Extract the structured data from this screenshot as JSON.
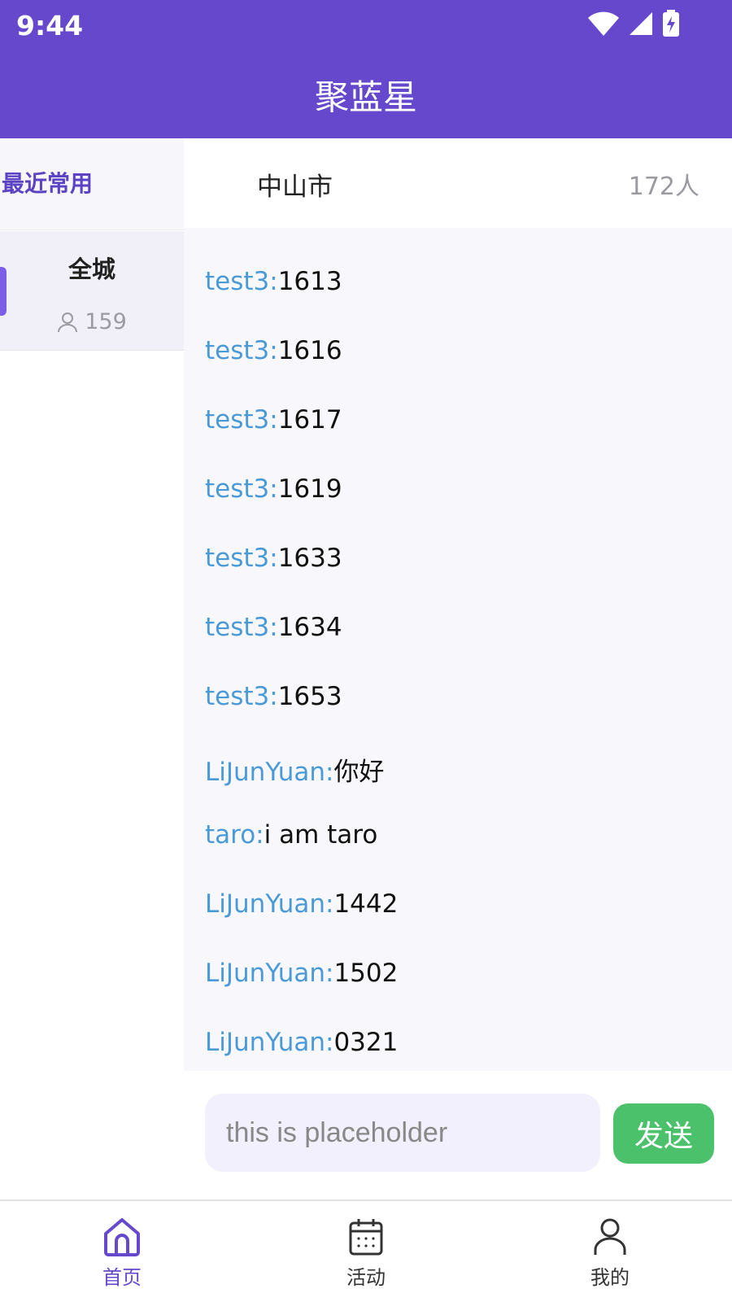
{
  "status_bar": {
    "time": "9:44"
  },
  "header": {
    "title": "聚蓝星"
  },
  "sidebar": {
    "recent_label": "最近常用",
    "city": {
      "name": "全城",
      "count": "159"
    }
  },
  "chat": {
    "room_name": "中山市",
    "room_count": "172人",
    "clipped_text": "",
    "messages": [
      {
        "user": "test3:",
        "text": "1613"
      },
      {
        "user": "test3:",
        "text": "1616"
      },
      {
        "user": "test3:",
        "text": "1617"
      },
      {
        "user": "test3:",
        "text": "1619"
      },
      {
        "user": "test3:",
        "text": "1633"
      },
      {
        "user": "test3:",
        "text": "1634"
      },
      {
        "user": "test3:",
        "text": "1653"
      },
      {
        "user": "LiJunYuan:",
        "text": "你好"
      },
      {
        "user": "taro:",
        "text": "i am taro"
      },
      {
        "user": "LiJunYuan:",
        "text": "1442"
      },
      {
        "user": "LiJunYuan:",
        "text": "1502"
      },
      {
        "user": "LiJunYuan:",
        "text": "0321"
      }
    ],
    "input_placeholder": "this is placeholder",
    "send_label": "发送"
  },
  "nav": {
    "items": [
      {
        "label": "首页",
        "icon": "home-icon",
        "active": true
      },
      {
        "label": "活动",
        "icon": "calendar-icon",
        "active": false
      },
      {
        "label": "我的",
        "icon": "user-icon",
        "active": false
      }
    ]
  },
  "colors": {
    "primary": "#6548cc",
    "username": "#4a9ad8",
    "send": "#4cc16b"
  }
}
